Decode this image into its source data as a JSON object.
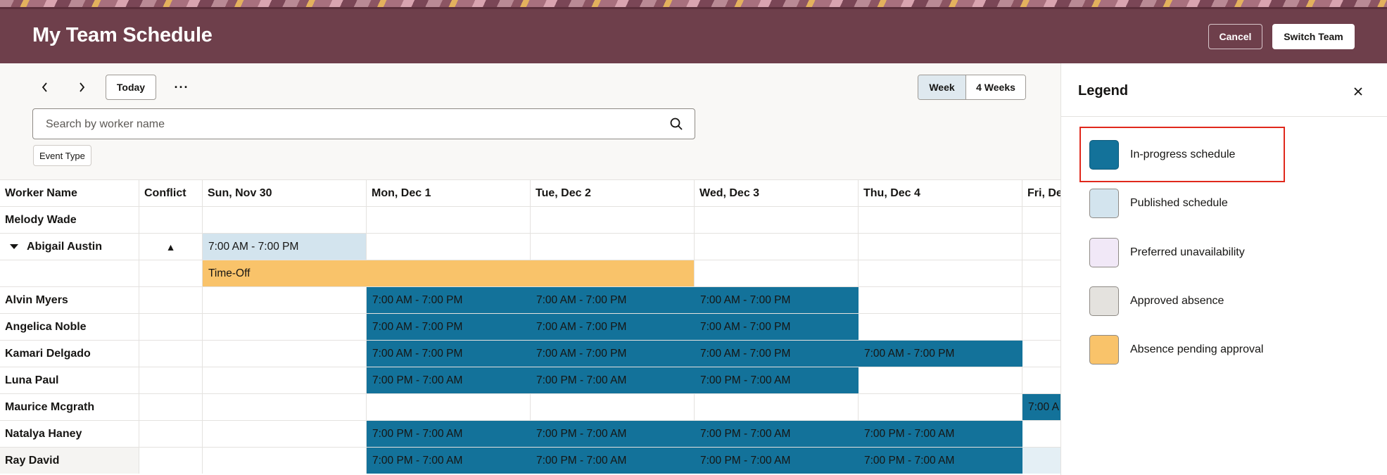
{
  "header": {
    "title": "My Team Schedule",
    "cancel_label": "Cancel",
    "switch_team_label": "Switch Team"
  },
  "toolbar": {
    "prev_icon": "chevron-left-icon",
    "next_icon": "chevron-right-icon",
    "today_label": "Today",
    "more_label": "···",
    "view_week_label": "Week",
    "view_4weeks_label": "4 Weeks",
    "selected_view": "Week"
  },
  "search": {
    "placeholder": "Search by worker name"
  },
  "filters": {
    "event_type_label": "Event Type"
  },
  "grid": {
    "columns": [
      "Worker Name",
      "Conflict",
      "Sun, Nov 30",
      "Mon, Dec 1",
      "Tue, Dec 2",
      "Wed, Dec 3",
      "Thu, Dec 4",
      "Fri, De"
    ],
    "rows": [
      {
        "name": "Melody Wade",
        "conflict": "",
        "cells": [
          "",
          "",
          "",
          "",
          "",
          ""
        ]
      },
      {
        "name": "Abigail Austin",
        "conflict": "▲",
        "expanded": true,
        "cells": [
          "7:00 AM - 7:00 PM",
          "",
          "",
          "",
          "",
          ""
        ]
      },
      {
        "name": "",
        "conflict": "",
        "time_off_label": "Time-Off",
        "cells": [
          "",
          "",
          "",
          "",
          "",
          ""
        ]
      },
      {
        "name": "Alvin Myers",
        "conflict": "",
        "cells": [
          "",
          "7:00 AM - 7:00 PM",
          "7:00 AM - 7:00 PM",
          "7:00 AM - 7:00 PM",
          "",
          ""
        ]
      },
      {
        "name": "Angelica Noble",
        "conflict": "",
        "cells": [
          "",
          "7:00 AM - 7:00 PM",
          "7:00 AM - 7:00 PM",
          "7:00 AM - 7:00 PM",
          "",
          ""
        ]
      },
      {
        "name": "Kamari Delgado",
        "conflict": "",
        "cells": [
          "",
          "7:00 AM - 7:00 PM",
          "7:00 AM - 7:00 PM",
          "7:00 AM - 7:00 PM",
          "7:00 AM - 7:00 PM",
          ""
        ]
      },
      {
        "name": "Luna Paul",
        "conflict": "",
        "cells": [
          "",
          "7:00 PM - 7:00 AM",
          "7:00 PM - 7:00 AM",
          "7:00 PM - 7:00 AM",
          "",
          ""
        ]
      },
      {
        "name": "Maurice Mcgrath",
        "conflict": "",
        "cells": [
          "",
          "",
          "",
          "",
          "",
          "7:00 A"
        ]
      },
      {
        "name": "Natalya Haney",
        "conflict": "",
        "cells": [
          "",
          "7:00 PM - 7:00 AM",
          "7:00 PM - 7:00 AM",
          "7:00 PM - 7:00 AM",
          "7:00 PM - 7:00 AM",
          ""
        ]
      },
      {
        "name": "Ray David",
        "conflict": "",
        "cells": [
          "",
          "7:00 PM - 7:00 AM",
          "7:00 PM - 7:00 AM",
          "7:00 PM - 7:00 AM",
          "7:00 PM - 7:00 AM",
          ""
        ]
      }
    ]
  },
  "legend": {
    "title": "Legend",
    "close_icon": "close-icon",
    "items": [
      {
        "label": "In-progress schedule",
        "color": "#13729a"
      },
      {
        "label": "Published schedule",
        "color": "#d3e4ee"
      },
      {
        "label": "Preferred unavailability",
        "color": "#f1e8f7"
      },
      {
        "label": "Approved absence",
        "color": "#e4e2de"
      },
      {
        "label": "Absence pending approval",
        "color": "#f9c36a"
      }
    ]
  },
  "colors": {
    "header_bg": "#6e3f4b",
    "in_progress": "#13729a",
    "published": "#d3e4ee",
    "pending": "#f9c36a",
    "highlight": "#e0281c"
  }
}
